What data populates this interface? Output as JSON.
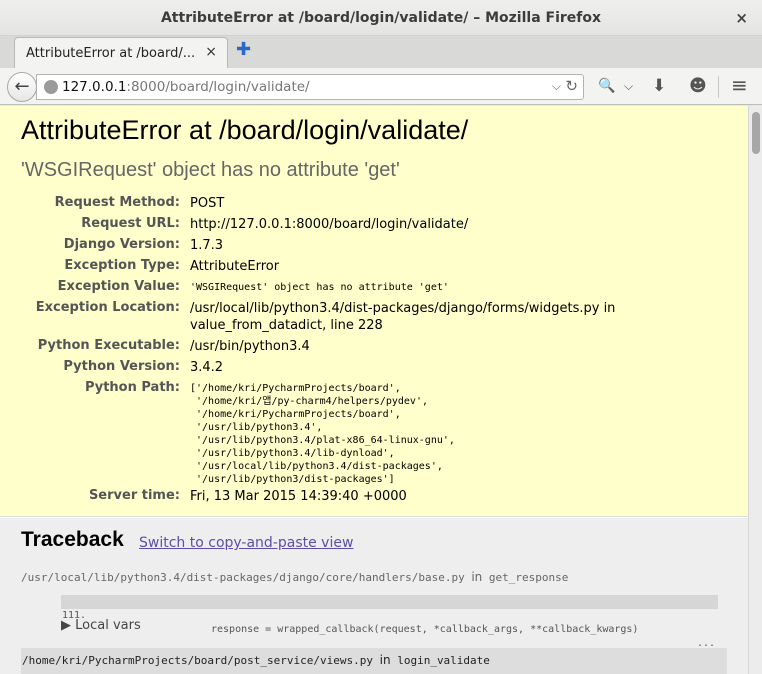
{
  "window": {
    "title": "AttributeError at /board/login/validate/ – Mozilla Firefox"
  },
  "tab": {
    "label": "AttributeError at /board/..."
  },
  "urlbar": {
    "host": "127.0.0.1",
    "rest": ":8000/board/login/validate/"
  },
  "icons": {
    "back": "←",
    "close": "×",
    "tab_close": "×",
    "new_tab": "✚",
    "dropdown": "⌵",
    "reload": "↻",
    "search": "🔍",
    "download": "⬇",
    "smiley": "☻",
    "menu": "≡"
  },
  "error": {
    "title": "AttributeError at /board/login/validate/",
    "message": "'WSGIRequest' object has no attribute 'get'",
    "meta": [
      {
        "key": "Request Method:",
        "value": "POST"
      },
      {
        "key": "Request URL:",
        "value": "http://127.0.0.1:8000/board/login/validate/"
      },
      {
        "key": "Django Version:",
        "value": "1.7.3"
      },
      {
        "key": "Exception Type:",
        "value": "AttributeError"
      },
      {
        "key": "Exception Value:",
        "value": "'WSGIRequest' object has no attribute 'get'"
      },
      {
        "key": "Exception Location:",
        "value": "/usr/local/lib/python3.4/dist-packages/django/forms/widgets.py in",
        "value2": "value_from_datadict, line 228"
      },
      {
        "key": "Python Executable:",
        "value": "/usr/bin/python3.4"
      },
      {
        "key": "Python Version:",
        "value": "3.4.2"
      },
      {
        "key": "Python Path:",
        "lines": [
          "['/home/kri/PycharmProjects/board',",
          " '/home/kri/앱/py-charm4/helpers/pydev',",
          " '/home/kri/PycharmProjects/board',",
          " '/usr/lib/python3.4',",
          " '/usr/lib/python3.4/plat-x86_64-linux-gnu',",
          " '/usr/lib/python3.4/lib-dynload',",
          " '/usr/local/lib/python3.4/dist-packages',",
          " '/usr/lib/python3/dist-packages']"
        ]
      },
      {
        "key": "Server time:",
        "value": "Fri, 13 Mar 2015 14:39:40 +0000"
      }
    ]
  },
  "traceback": {
    "heading": "Traceback",
    "switch_link": "Switch to copy-and-paste view",
    "frames": [
      {
        "file": "/usr/local/lib/python3.4/dist-packages/django/core/handlers/base.py",
        "in": "in",
        "func": "get_response",
        "line_no": "111.",
        "code": "response = wrapped_callback(request, *callback_args, **callback_kwargs)",
        "ellipsis": "...",
        "local_vars": "▶ Local vars"
      },
      {
        "file": "/home/kri/PycharmProjects/board/post_service/views.py",
        "in": "in",
        "func": "login_validate"
      }
    ]
  }
}
